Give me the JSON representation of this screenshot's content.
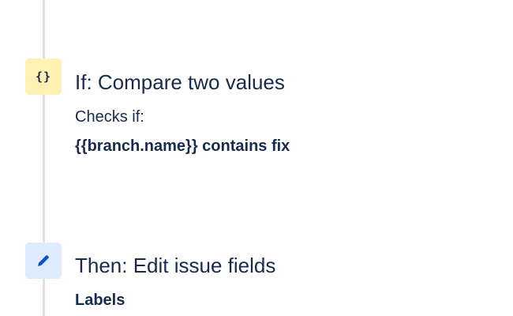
{
  "steps": [
    {
      "icon": "curly-braces-icon",
      "icon_text": "{}",
      "title": "If: Compare two values",
      "description": "Checks if:",
      "detail": "{{branch.name}} contains fix"
    },
    {
      "icon": "pencil-icon",
      "title": "Then: Edit issue fields",
      "detail": "Labels"
    }
  ],
  "colors": {
    "text": "#172b4d",
    "timeline": "#dfe1e6",
    "condition_icon_bg": "#fff0b3",
    "action_icon_bg": "#deebff",
    "action_icon_fg": "#0052cc"
  }
}
